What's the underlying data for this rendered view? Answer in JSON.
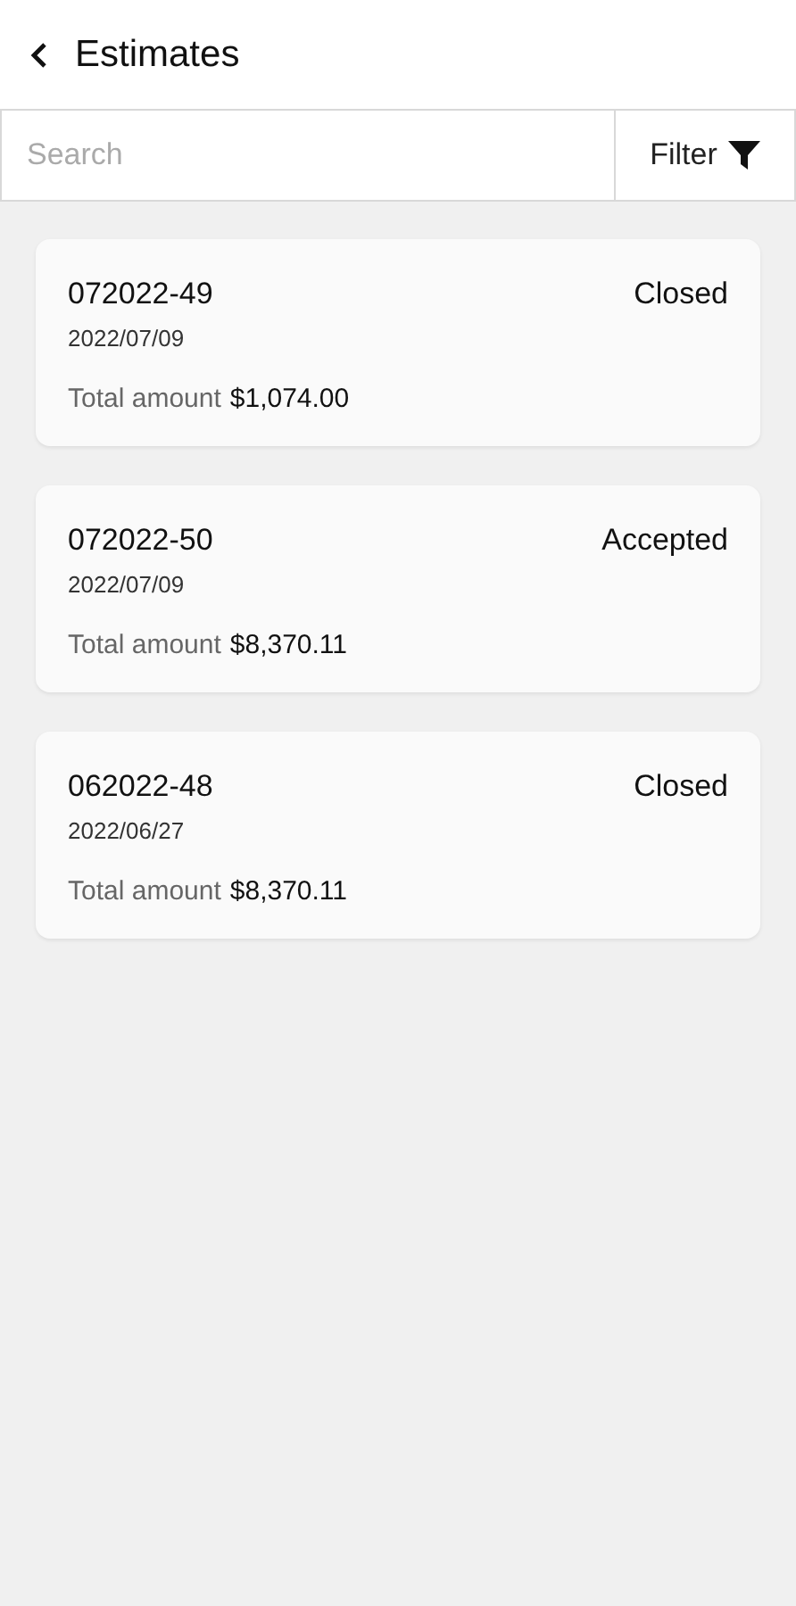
{
  "header": {
    "title": "Estimates"
  },
  "search": {
    "placeholder": "Search"
  },
  "filter": {
    "label": "Filter"
  },
  "estimates": [
    {
      "number": "072022-49",
      "date": "2022/07/09",
      "status": "Closed",
      "total_label": "Total amount",
      "total": "$1,074.00"
    },
    {
      "number": "072022-50",
      "date": "2022/07/09",
      "status": "Accepted",
      "total_label": "Total amount",
      "total": "$8,370.11"
    },
    {
      "number": "062022-48",
      "date": "2022/06/27",
      "status": "Closed",
      "total_label": "Total amount",
      "total": "$8,370.11"
    }
  ]
}
